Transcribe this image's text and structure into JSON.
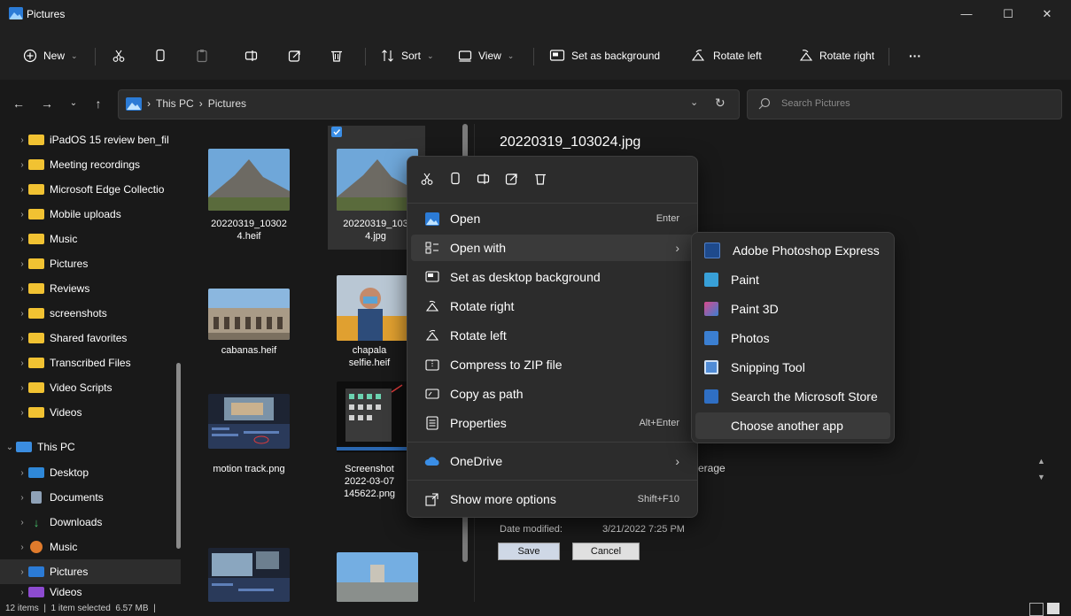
{
  "window": {
    "title": "Pictures",
    "min": "—",
    "max": "☐",
    "close": "✕"
  },
  "toolbar": {
    "new_label": "New",
    "sort_label": "Sort",
    "view_label": "View",
    "set_bg_label": "Set as background",
    "rotate_left_label": "Rotate left",
    "rotate_right_label": "Rotate right",
    "more_label": "···"
  },
  "nav": {
    "breadcrumb": [
      "This PC",
      "Pictures"
    ],
    "search_placeholder": "Search Pictures"
  },
  "sidebar": {
    "items": [
      {
        "label": "iPadOS 15 review ben_fil",
        "type": "folder"
      },
      {
        "label": "Meeting recordings",
        "type": "folder"
      },
      {
        "label": "Microsoft Edge Collectio",
        "type": "folder"
      },
      {
        "label": "Mobile uploads",
        "type": "folder"
      },
      {
        "label": "Music",
        "type": "folder"
      },
      {
        "label": "Pictures",
        "type": "folder"
      },
      {
        "label": "Reviews",
        "type": "folder"
      },
      {
        "label": "screenshots",
        "type": "folder"
      },
      {
        "label": "Shared favorites",
        "type": "folder"
      },
      {
        "label": "Transcribed Files",
        "type": "folder"
      },
      {
        "label": "Video Scripts",
        "type": "folder"
      },
      {
        "label": "Videos",
        "type": "folder"
      },
      {
        "label": "This PC",
        "type": "pc"
      },
      {
        "label": "Desktop",
        "type": "desktop"
      },
      {
        "label": "Documents",
        "type": "docs"
      },
      {
        "label": "Downloads",
        "type": "downloads"
      },
      {
        "label": "Music",
        "type": "music"
      },
      {
        "label": "Pictures",
        "type": "pictures"
      },
      {
        "label": "Videos",
        "type": "videos"
      }
    ]
  },
  "files": [
    {
      "name_line1": "20220319_10302",
      "name_line2": "4.heif"
    },
    {
      "name_line1": "20220319_103",
      "name_line2": "4.jpg"
    },
    {
      "name_line1": "cabanas.heif",
      "name_line2": ""
    },
    {
      "name_line1": "chapala",
      "name_line2": "selfie.heif"
    },
    {
      "name_line1": "motion track.png",
      "name_line2": ""
    },
    {
      "name_line1": "Screenshot",
      "name_line2": "2022-03-07",
      "name_line3": "145622.png"
    }
  ],
  "details": {
    "file_title": "20220319_103024.jpg",
    "partial_text": "erage",
    "date_modified_label": "Date modified:",
    "date_modified_value": "3/21/2022 7:25 PM",
    "save_label": "Save",
    "cancel_label": "Cancel"
  },
  "status": {
    "text": "12 items  |  1 item selected  6.57 MB  |"
  },
  "context_menu": {
    "open": {
      "label": "Open",
      "shortcut": "Enter"
    },
    "open_with": {
      "label": "Open with",
      "arrow": "›"
    },
    "set_bg": {
      "label": "Set as desktop background"
    },
    "rotate_right": {
      "label": "Rotate right"
    },
    "rotate_left": {
      "label": "Rotate left"
    },
    "compress": {
      "label": "Compress to ZIP file"
    },
    "copy_path": {
      "label": "Copy as path"
    },
    "properties": {
      "label": "Properties",
      "shortcut": "Alt+Enter"
    },
    "onedrive": {
      "label": "OneDrive",
      "arrow": "›"
    },
    "more": {
      "label": "Show more options",
      "shortcut": "Shift+F10"
    }
  },
  "open_with_menu": [
    {
      "label": "Adobe Photoshop Express",
      "color": "#1e4a8c"
    },
    {
      "label": "Paint",
      "color": "#38a0d8"
    },
    {
      "label": "Paint 3D",
      "color": "#d94a8c"
    },
    {
      "label": "Photos",
      "color": "#3b7fd1"
    },
    {
      "label": "Snipping Tool",
      "color": "#4f8bd6"
    },
    {
      "label": "Search the Microsoft Store",
      "color": "#2f6fc4"
    },
    {
      "label": "Choose another app",
      "color": ""
    }
  ]
}
